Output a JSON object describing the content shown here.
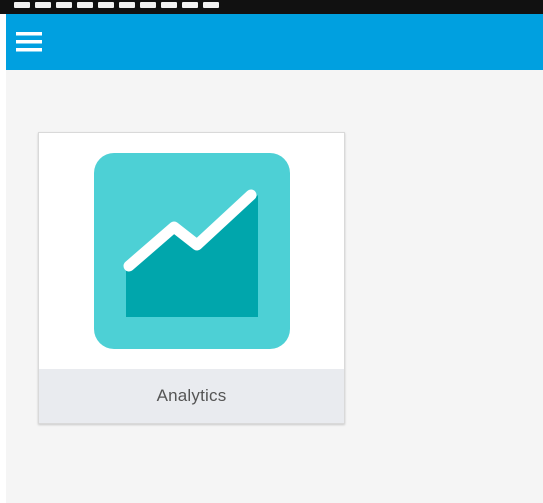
{
  "apps": [
    {
      "label": "Analytics",
      "icon": "analytics-chart-icon"
    }
  ],
  "colors": {
    "app_bar": "#00a0e0",
    "status_bar": "#111111",
    "content_background": "#f5f5f5",
    "tile_label_background": "#e9ebef",
    "icon_background": "#4dd0d5",
    "icon_area_fill": "#00a6ac",
    "icon_line": "#ffffff"
  },
  "icons": {
    "menu": "hamburger-menu-icon"
  }
}
